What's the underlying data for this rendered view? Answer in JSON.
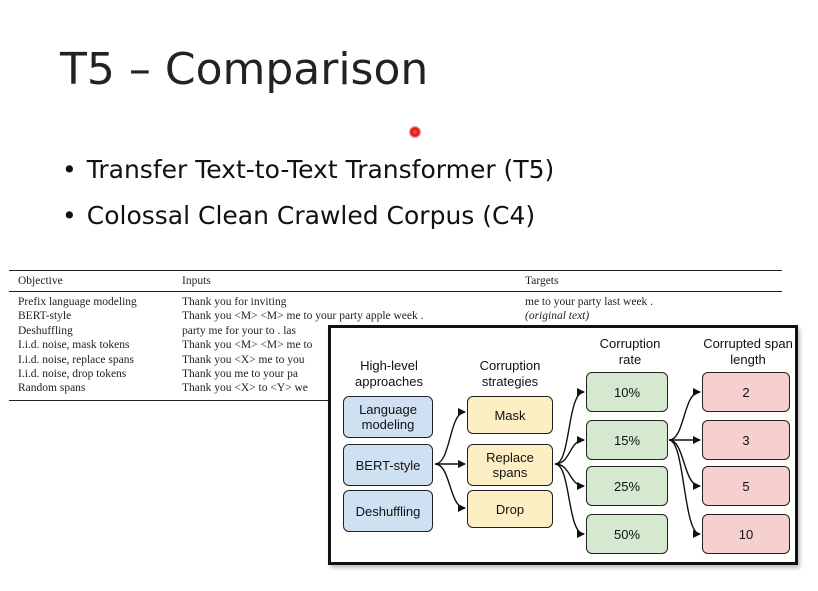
{
  "slide": {
    "title": "T5 – Comparison",
    "bullets": [
      "Transfer Text-to-Text Transformer (T5)",
      "Colossal Clean Crawled Corpus (C4)"
    ]
  },
  "table": {
    "headers": [
      "Objective",
      "Inputs",
      "Targets"
    ],
    "rows": [
      {
        "objective": "Prefix language modeling",
        "inputs": "Thank you for inviting",
        "targets": "me to your party last week ."
      },
      {
        "objective": "BERT-style",
        "inputs": "Thank you <M> <M> me to your party apple week .",
        "targets": "(original text)"
      },
      {
        "objective": "Deshuffling",
        "inputs": "party me for your to . las",
        "targets": ""
      },
      {
        "objective": "I.i.d. noise, mask tokens",
        "inputs": "Thank you <M> <M> me to",
        "targets": ""
      },
      {
        "objective": "I.i.d. noise, replace spans",
        "inputs": "Thank you <X> me to you",
        "targets": ""
      },
      {
        "objective": "I.i.d. noise, drop tokens",
        "inputs": "Thank you me to your pa",
        "targets": ""
      },
      {
        "objective": "Random spans",
        "inputs": "Thank you <X> to <Y> we",
        "targets": ""
      }
    ]
  },
  "diagram": {
    "headers": {
      "approaches": "High-level approaches",
      "strategies": "Corruption strategies",
      "rate": "Corruption rate",
      "span": "Corrupted span length"
    },
    "approaches": [
      "Language modeling",
      "BERT-style",
      "Deshuffling"
    ],
    "strategies": [
      "Mask",
      "Replace spans",
      "Drop"
    ],
    "rates": [
      "10%",
      "15%",
      "25%",
      "50%"
    ],
    "spans": [
      "2",
      "3",
      "5",
      "10"
    ],
    "colors": {
      "approach": "#cfe0f3",
      "strategy": "#fdefc3",
      "rate": "#d5e8d0",
      "span": "#f6cfcf"
    }
  }
}
